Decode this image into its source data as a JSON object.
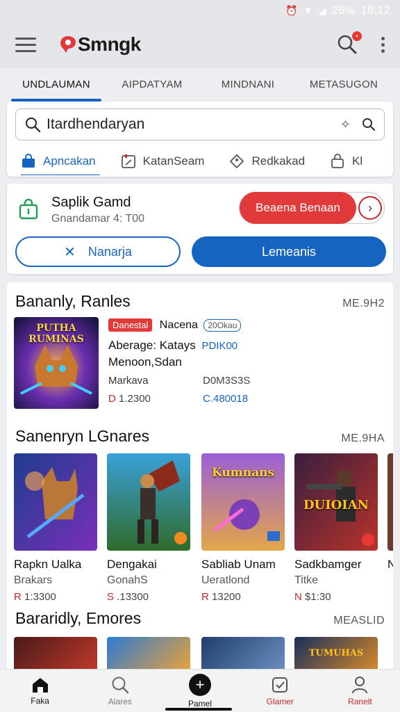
{
  "status": {
    "percent": "26%",
    "time": "18:12"
  },
  "app": {
    "name": "Smngk"
  },
  "tabs": [
    "UNDLAUMAN",
    "AIPDATYAM",
    "MINDNANI",
    "METASUGON"
  ],
  "search": {
    "value": "Itardhendaryan"
  },
  "filters": [
    "Apncakan",
    "KatanSeam",
    "Redkakad",
    "Kl"
  ],
  "user": {
    "name": "Saplik Gamd",
    "sub": "Gnandamar 4: T00",
    "pill_label": "Beaena Benaan",
    "outline_btn": "Nanarja",
    "solid_btn": "Lemeanis"
  },
  "sections": [
    {
      "title": "Bananly, Ranles",
      "more": "ME.9H2"
    },
    {
      "title": "Sanenryn LGnares",
      "more": "ME.9HA"
    },
    {
      "title": "Bararidly, Emores",
      "more": "MEASLID"
    }
  ],
  "featured": {
    "art_text": "PUTHA RUMINAS",
    "badge": "Danestal",
    "name": "Nacena",
    "tag": "20Okau",
    "line1_label": "Aberage: Katays",
    "line1_value": "PDIK00",
    "line2": "Menoon,Sdan",
    "line3_label": "Markava",
    "line3_value": "D0M3S3S",
    "price_a_cur": "D",
    "price_a": "1.2300",
    "price_b": "C.480018"
  },
  "cards": [
    {
      "title": "Rapkn Ualka",
      "sub": "Brakars",
      "cur": "R",
      "price": "1:3300",
      "art_text": ""
    },
    {
      "title": "Dengakai",
      "sub": "GonahS",
      "cur": "S",
      "price": ".13300",
      "art_text": ""
    },
    {
      "title": "Sabliab Unam",
      "sub": "Ueratlond",
      "cur": "R",
      "price": "13200",
      "art_text": "Kumnans"
    },
    {
      "title": "Sadkbamger",
      "sub": "Titke",
      "cur": "N",
      "price": "$1:30",
      "art_text": "DUIOIAN"
    },
    {
      "title": "N",
      "sub": "",
      "cur": "",
      "price": "",
      "art_text": ""
    }
  ],
  "thumbs": [
    "",
    "",
    "",
    "TUMUHAS"
  ],
  "nav": [
    "Faka",
    "Alares",
    "Pamel",
    "Glamer",
    "Ranelt"
  ],
  "colors": {
    "accent": "#1565c0",
    "danger": "#e03a3a"
  }
}
